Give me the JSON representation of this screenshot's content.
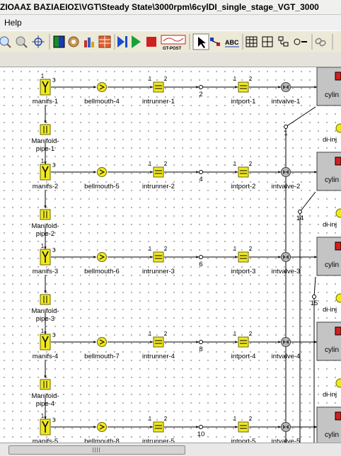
{
  "window": {
    "title": "ΖΙΟΑΑΣ ΒΑΣΙΑΕΙΟΣ\\VGT\\Steady State\\3000rpm\\6cylDI_single_stage_VGT_3000"
  },
  "menu": {
    "items": [
      "Help"
    ]
  },
  "toolbar": {
    "gtpost_label": "GT-POST",
    "abc_label": "ABC"
  },
  "model": {
    "rows": [
      {
        "manifold": "manifs-1",
        "bellmouth": "bellmouth-4",
        "runner": "intrunner-1",
        "node": "2",
        "port": "intport-1",
        "valve": "intvalve-1",
        "cylinder": "cylin"
      },
      {
        "manifold": "manifs-2",
        "bellmouth": "bellmouth-5",
        "runner": "intrunner-2",
        "node": "4",
        "port": "intport-2",
        "valve": "intvalve-2",
        "cylinder": "cylin"
      },
      {
        "manifold": "manifs-3",
        "bellmouth": "bellmouth-6",
        "runner": "intrunner-3",
        "node": "6",
        "port": "intport-3",
        "valve": "intvalve-3",
        "cylinder": "cylin"
      },
      {
        "manifold": "manifs-4",
        "bellmouth": "bellmouth-7",
        "runner": "intrunner-4",
        "node": "8",
        "port": "intport-4",
        "valve": "intvalve-4",
        "cylinder": "cylin"
      },
      {
        "manifold": "manifs-5",
        "bellmouth": "bellmouth-8",
        "runner": "intrunner-5",
        "node": "10",
        "port": "intport-5",
        "valve": "intvalve-5",
        "cylinder": "cylin"
      }
    ],
    "pipes": [
      {
        "line1": "Manifold-",
        "line2": "pipe-1"
      },
      {
        "line1": "Manifold-",
        "line2": "pipe-2"
      },
      {
        "line1": "Manifold-",
        "line2": "pipe-3"
      },
      {
        "line1": "Manifold-",
        "line2": "pipe-4"
      }
    ],
    "injectors": [
      "di-inj",
      "di-inj",
      "di-inj",
      "di-inj"
    ],
    "junctions": [
      "1",
      "14",
      "15"
    ],
    "port_numbers": {
      "left": "1",
      "right": "2",
      "three": "3"
    }
  }
}
